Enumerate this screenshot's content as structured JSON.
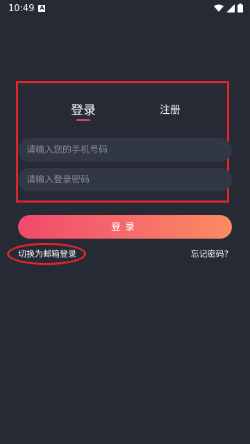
{
  "status_bar": {
    "time": "10:49",
    "notification_icon": "A",
    "icons": [
      "wifi-icon",
      "signal-icon",
      "battery-icon"
    ]
  },
  "tabs": {
    "login_label": "登录",
    "register_label": "注册"
  },
  "form": {
    "phone_placeholder": "请输入您的手机号码",
    "password_placeholder": "请输入登录密码",
    "phone_value": "",
    "password_value": ""
  },
  "login_button_label": "登录",
  "links": {
    "switch_email": "切换为邮箱登录",
    "forgot_password": "忘记密码?"
  },
  "colors": {
    "background": "#262a35",
    "input_bg": "#323746",
    "accent": "#f2516b",
    "gradient_start": "#f24a6c",
    "gradient_end": "#fb8b62",
    "annotation": "#e0262c"
  }
}
